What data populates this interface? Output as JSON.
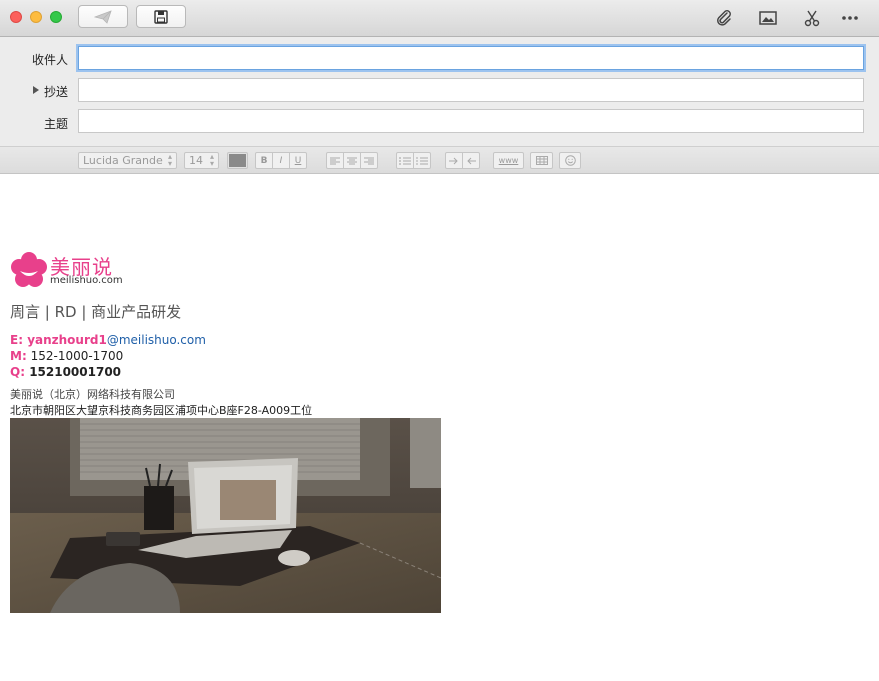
{
  "header": {
    "to_label": "收件人",
    "cc_label": "抄送",
    "subject_label": "主题",
    "to_value": "",
    "cc_value": "",
    "subject_value": ""
  },
  "format_bar": {
    "font_name": "Lucida Grande",
    "font_size": "14",
    "link_label": "www"
  },
  "signature": {
    "logo_text": "美丽说",
    "logo_domain": "meilishuo.com",
    "title_line": "周言 | RD | 商业产品研发",
    "email_label": "E:",
    "email_user": "yanzhourd1",
    "email_domain": "@meilishuo.com",
    "mobile_label": "M:",
    "mobile_value": "152-1000-1700",
    "qq_label": "Q:",
    "qq_value": "15210001700",
    "company": "美丽说（北京）网络科技有限公司",
    "address": "北京市朝阳区大望京科技商务园区浦项中心B座F28-A009工位"
  },
  "colors": {
    "brand_pink": "#e8408b",
    "link_blue": "#1f5fa8",
    "focus_blue": "#6aa3e0"
  }
}
